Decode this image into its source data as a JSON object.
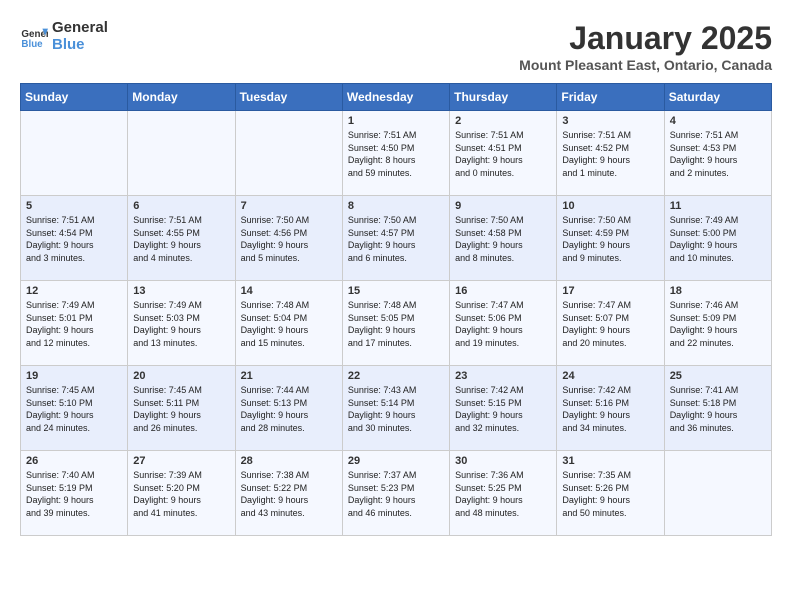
{
  "logo": {
    "line1": "General",
    "line2": "Blue"
  },
  "title": "January 2025",
  "subtitle": "Mount Pleasant East, Ontario, Canada",
  "days_of_week": [
    "Sunday",
    "Monday",
    "Tuesday",
    "Wednesday",
    "Thursday",
    "Friday",
    "Saturday"
  ],
  "weeks": [
    [
      {
        "day": "",
        "info": ""
      },
      {
        "day": "",
        "info": ""
      },
      {
        "day": "",
        "info": ""
      },
      {
        "day": "1",
        "info": "Sunrise: 7:51 AM\nSunset: 4:50 PM\nDaylight: 8 hours\nand 59 minutes."
      },
      {
        "day": "2",
        "info": "Sunrise: 7:51 AM\nSunset: 4:51 PM\nDaylight: 9 hours\nand 0 minutes."
      },
      {
        "day": "3",
        "info": "Sunrise: 7:51 AM\nSunset: 4:52 PM\nDaylight: 9 hours\nand 1 minute."
      },
      {
        "day": "4",
        "info": "Sunrise: 7:51 AM\nSunset: 4:53 PM\nDaylight: 9 hours\nand 2 minutes."
      }
    ],
    [
      {
        "day": "5",
        "info": "Sunrise: 7:51 AM\nSunset: 4:54 PM\nDaylight: 9 hours\nand 3 minutes."
      },
      {
        "day": "6",
        "info": "Sunrise: 7:51 AM\nSunset: 4:55 PM\nDaylight: 9 hours\nand 4 minutes."
      },
      {
        "day": "7",
        "info": "Sunrise: 7:50 AM\nSunset: 4:56 PM\nDaylight: 9 hours\nand 5 minutes."
      },
      {
        "day": "8",
        "info": "Sunrise: 7:50 AM\nSunset: 4:57 PM\nDaylight: 9 hours\nand 6 minutes."
      },
      {
        "day": "9",
        "info": "Sunrise: 7:50 AM\nSunset: 4:58 PM\nDaylight: 9 hours\nand 8 minutes."
      },
      {
        "day": "10",
        "info": "Sunrise: 7:50 AM\nSunset: 4:59 PM\nDaylight: 9 hours\nand 9 minutes."
      },
      {
        "day": "11",
        "info": "Sunrise: 7:49 AM\nSunset: 5:00 PM\nDaylight: 9 hours\nand 10 minutes."
      }
    ],
    [
      {
        "day": "12",
        "info": "Sunrise: 7:49 AM\nSunset: 5:01 PM\nDaylight: 9 hours\nand 12 minutes."
      },
      {
        "day": "13",
        "info": "Sunrise: 7:49 AM\nSunset: 5:03 PM\nDaylight: 9 hours\nand 13 minutes."
      },
      {
        "day": "14",
        "info": "Sunrise: 7:48 AM\nSunset: 5:04 PM\nDaylight: 9 hours\nand 15 minutes."
      },
      {
        "day": "15",
        "info": "Sunrise: 7:48 AM\nSunset: 5:05 PM\nDaylight: 9 hours\nand 17 minutes."
      },
      {
        "day": "16",
        "info": "Sunrise: 7:47 AM\nSunset: 5:06 PM\nDaylight: 9 hours\nand 19 minutes."
      },
      {
        "day": "17",
        "info": "Sunrise: 7:47 AM\nSunset: 5:07 PM\nDaylight: 9 hours\nand 20 minutes."
      },
      {
        "day": "18",
        "info": "Sunrise: 7:46 AM\nSunset: 5:09 PM\nDaylight: 9 hours\nand 22 minutes."
      }
    ],
    [
      {
        "day": "19",
        "info": "Sunrise: 7:45 AM\nSunset: 5:10 PM\nDaylight: 9 hours\nand 24 minutes."
      },
      {
        "day": "20",
        "info": "Sunrise: 7:45 AM\nSunset: 5:11 PM\nDaylight: 9 hours\nand 26 minutes."
      },
      {
        "day": "21",
        "info": "Sunrise: 7:44 AM\nSunset: 5:13 PM\nDaylight: 9 hours\nand 28 minutes."
      },
      {
        "day": "22",
        "info": "Sunrise: 7:43 AM\nSunset: 5:14 PM\nDaylight: 9 hours\nand 30 minutes."
      },
      {
        "day": "23",
        "info": "Sunrise: 7:42 AM\nSunset: 5:15 PM\nDaylight: 9 hours\nand 32 minutes."
      },
      {
        "day": "24",
        "info": "Sunrise: 7:42 AM\nSunset: 5:16 PM\nDaylight: 9 hours\nand 34 minutes."
      },
      {
        "day": "25",
        "info": "Sunrise: 7:41 AM\nSunset: 5:18 PM\nDaylight: 9 hours\nand 36 minutes."
      }
    ],
    [
      {
        "day": "26",
        "info": "Sunrise: 7:40 AM\nSunset: 5:19 PM\nDaylight: 9 hours\nand 39 minutes."
      },
      {
        "day": "27",
        "info": "Sunrise: 7:39 AM\nSunset: 5:20 PM\nDaylight: 9 hours\nand 41 minutes."
      },
      {
        "day": "28",
        "info": "Sunrise: 7:38 AM\nSunset: 5:22 PM\nDaylight: 9 hours\nand 43 minutes."
      },
      {
        "day": "29",
        "info": "Sunrise: 7:37 AM\nSunset: 5:23 PM\nDaylight: 9 hours\nand 46 minutes."
      },
      {
        "day": "30",
        "info": "Sunrise: 7:36 AM\nSunset: 5:25 PM\nDaylight: 9 hours\nand 48 minutes."
      },
      {
        "day": "31",
        "info": "Sunrise: 7:35 AM\nSunset: 5:26 PM\nDaylight: 9 hours\nand 50 minutes."
      },
      {
        "day": "",
        "info": ""
      }
    ]
  ]
}
